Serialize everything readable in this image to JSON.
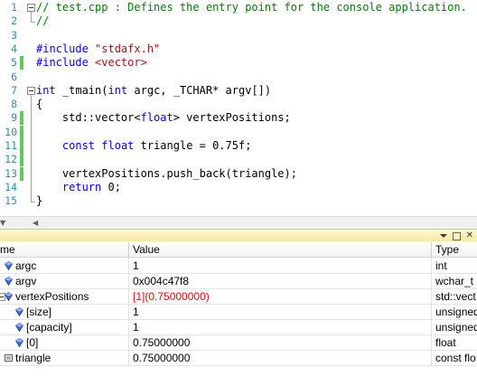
{
  "editor": {
    "lines": [
      {
        "num": "1",
        "tokens": [
          {
            "t": "// test.cpp : Defines the entry point for the console application.",
            "c": "comment"
          }
        ]
      },
      {
        "num": "2",
        "tokens": [
          {
            "t": "//",
            "c": "comment"
          }
        ]
      },
      {
        "num": "3",
        "tokens": []
      },
      {
        "num": "4",
        "tokens": [
          {
            "t": "#include ",
            "c": "pre"
          },
          {
            "t": "\"stdafx.h\"",
            "c": "str"
          }
        ]
      },
      {
        "num": "5",
        "tokens": [
          {
            "t": "#include ",
            "c": "pre"
          },
          {
            "t": "<vector>",
            "c": "str"
          }
        ]
      },
      {
        "num": "6",
        "tokens": []
      },
      {
        "num": "7",
        "tokens": [
          {
            "t": "int",
            "c": "kw"
          },
          {
            "t": " _tmain(",
            "c": ""
          },
          {
            "t": "int",
            "c": "kw"
          },
          {
            "t": " argc, _TCHAR* argv[])",
            "c": ""
          }
        ]
      },
      {
        "num": "8",
        "tokens": [
          {
            "t": "{",
            "c": ""
          }
        ]
      },
      {
        "num": "9",
        "tokens": [
          {
            "t": "    std::vector<",
            "c": ""
          },
          {
            "t": "float",
            "c": "kw"
          },
          {
            "t": "> vertexPositions;",
            "c": ""
          }
        ]
      },
      {
        "num": "10",
        "tokens": []
      },
      {
        "num": "11",
        "tokens": [
          {
            "t": "    ",
            "c": ""
          },
          {
            "t": "const",
            "c": "kw"
          },
          {
            "t": " ",
            "c": ""
          },
          {
            "t": "float",
            "c": "kw"
          },
          {
            "t": " triangle = 0.75f;",
            "c": ""
          }
        ]
      },
      {
        "num": "12",
        "tokens": []
      },
      {
        "num": "13",
        "tokens": [
          {
            "t": "    vertexPositions.push_back(triangle);",
            "c": ""
          }
        ]
      },
      {
        "num": "14",
        "tokens": [
          {
            "t": "    ",
            "c": ""
          },
          {
            "t": "return",
            "c": "kw"
          },
          {
            "t": " 0;",
            "c": ""
          }
        ]
      },
      {
        "num": "15",
        "tokens": [
          {
            "t": "}",
            "c": ""
          }
        ]
      }
    ]
  },
  "locals": {
    "columns": {
      "name": "me",
      "value": "Value",
      "type": "Type"
    },
    "rows": [
      {
        "name": "argc",
        "value": "1",
        "type": "int",
        "level": 0,
        "expander": false,
        "changed": false,
        "icon": "variable-icon"
      },
      {
        "name": "argv",
        "value": "0x004c47f8",
        "type": "wchar_t",
        "level": 0,
        "expander": false,
        "changed": false,
        "icon": "variable-icon"
      },
      {
        "name": "vertexPositions",
        "value": "[1](0.75000000)",
        "type": "std::vect",
        "level": 0,
        "expander": true,
        "changed": true,
        "icon": "variable-icon"
      },
      {
        "name": "[size]",
        "value": "1",
        "type": "unsigned",
        "level": 1,
        "expander": false,
        "changed": false,
        "icon": "variable-icon"
      },
      {
        "name": "[capacity]",
        "value": "1",
        "type": "unsigned",
        "level": 1,
        "expander": false,
        "changed": false,
        "icon": "variable-icon"
      },
      {
        "name": "[0]",
        "value": "0.75000000",
        "type": "float",
        "level": 1,
        "expander": false,
        "changed": false,
        "icon": "variable-icon"
      },
      {
        "name": "triangle",
        "value": "0.75000000",
        "type": "const flo",
        "level": 0,
        "expander": false,
        "changed": false,
        "icon": "constant-icon"
      }
    ]
  },
  "colors": {
    "line_number": "#2b91af",
    "keyword": "#0000ff",
    "comment": "#008000",
    "string": "#a31515",
    "change_marker_saved": "#5ccb5c",
    "changed_value": "#ff0000",
    "panel_title_bg": "#fdf4bf"
  }
}
